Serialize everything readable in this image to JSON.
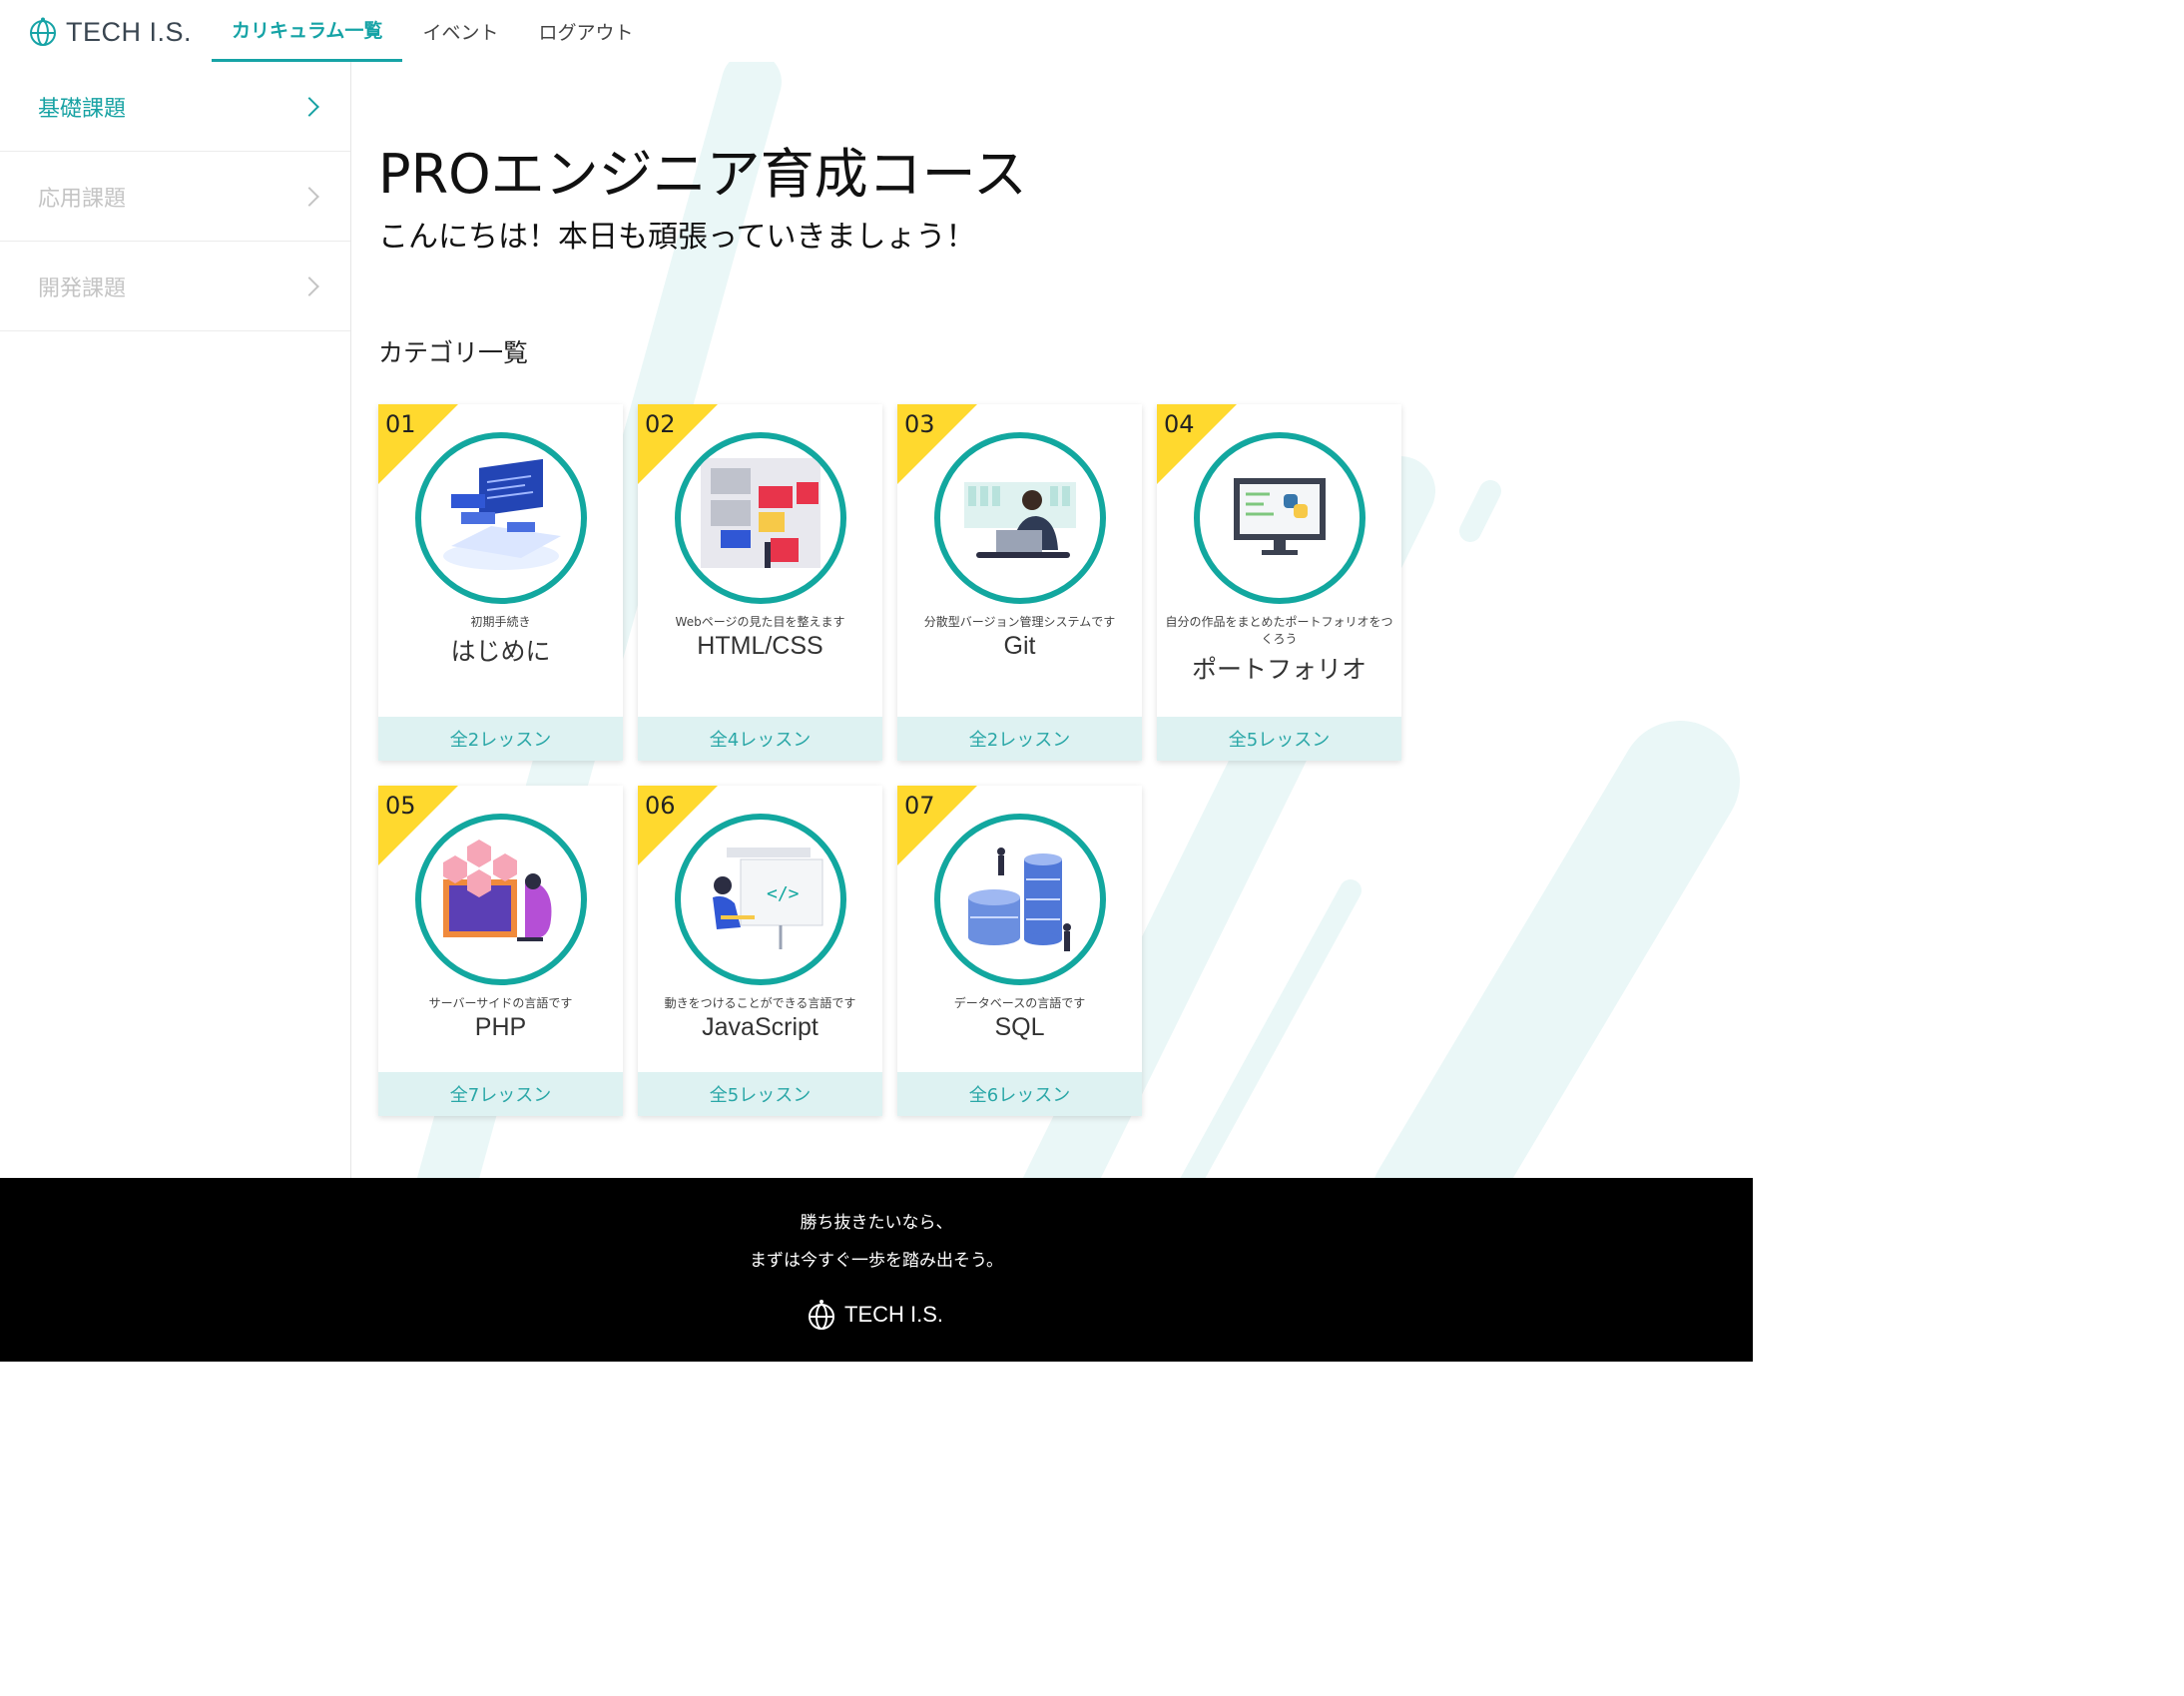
{
  "brand": {
    "name": "TECH I.S.",
    "accent": "#16a3a6"
  },
  "nav": {
    "items": [
      {
        "label": "カリキュラム一覧",
        "active": true
      },
      {
        "label": "イベント",
        "active": false
      },
      {
        "label": "ログアウト",
        "active": false
      }
    ]
  },
  "sidebar": {
    "items": [
      {
        "label": "基礎課題",
        "active": true
      },
      {
        "label": "応用課題",
        "active": false
      },
      {
        "label": "開発課題",
        "active": false
      }
    ]
  },
  "main": {
    "title": "PROエンジニア育成コース",
    "greeting": "こんにちは！本日も頑張っていきましょう！",
    "section_title": "カテゴリ一覧",
    "categories": [
      {
        "num": "01",
        "desc": "初期手続き",
        "name": "はじめに",
        "lessons": "全2レッスン",
        "icon": "laptop-code-illustration"
      },
      {
        "num": "02",
        "desc": "Webページの見た目を整えます",
        "name": "HTML/CSS",
        "lessons": "全4レッスン",
        "icon": "web-layout-illustration"
      },
      {
        "num": "03",
        "desc": "分散型バージョン管理システムです",
        "name": "Git",
        "lessons": "全2レッスン",
        "icon": "developer-laptop-illustration"
      },
      {
        "num": "04",
        "desc": "自分の作品をまとめたポートフォリオをつくろう",
        "name": "ポートフォリオ",
        "lessons": "全5レッスン",
        "icon": "monitor-python-illustration"
      },
      {
        "num": "05",
        "desc": "サーバーサイドの言語です",
        "name": "PHP",
        "lessons": "全7レッスン",
        "icon": "hexagon-developer-illustration"
      },
      {
        "num": "06",
        "desc": "動きをつけることができる言語です",
        "name": "JavaScript",
        "lessons": "全5レッスン",
        "icon": "code-presentation-illustration"
      },
      {
        "num": "07",
        "desc": "データベースの言語です",
        "name": "SQL",
        "lessons": "全6レッスン",
        "icon": "database-servers-illustration"
      }
    ]
  },
  "footer": {
    "line1": "勝ち抜きたいなら、",
    "line2": "まずは今すぐ一歩を踏み出そう。",
    "brand": "TECH I.S."
  }
}
